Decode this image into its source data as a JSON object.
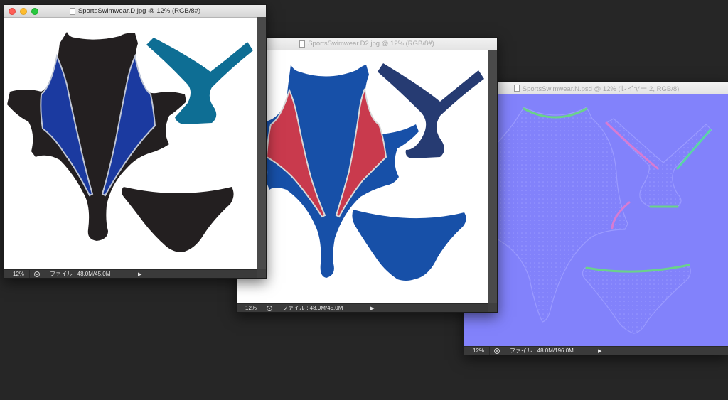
{
  "windows": [
    {
      "title": "SportsSwimwear.D.jpg @ 12% (RGB/8#)",
      "zoom": "12%",
      "file_info": "ファイル : 48.0M/45.0M",
      "active": true,
      "texture": "diffuse-black-blue"
    },
    {
      "title": "SportsSwimwear.D2.jpg @ 12% (RGB/8#)",
      "zoom": "12%",
      "file_info": "ファイル : 48.0M/45.0M",
      "active": false,
      "texture": "diffuse-blue-red"
    },
    {
      "title": "SportsSwimwear.N.psd @ 12% (レイヤー 2, RGB/8)",
      "zoom": "12%",
      "file_info": "ファイル : 48.0M/196.0M",
      "active": false,
      "texture": "normal-map"
    }
  ],
  "colors": {
    "desktop_bg": "#262626",
    "black_body": "#231f20",
    "blue_panel": "#1b3aa0",
    "teal_strap": "#0e6e94",
    "blue_body": "#1750a8",
    "red_panel": "#c93a4d",
    "navy_strap": "#263b72",
    "normal_bg": "#8080ff"
  },
  "icons": {
    "traffic_lights": [
      "close-icon",
      "minimize-icon",
      "zoom-icon"
    ],
    "document": "document-icon",
    "status": "status-icon",
    "arrow": "play-arrow-icon"
  }
}
